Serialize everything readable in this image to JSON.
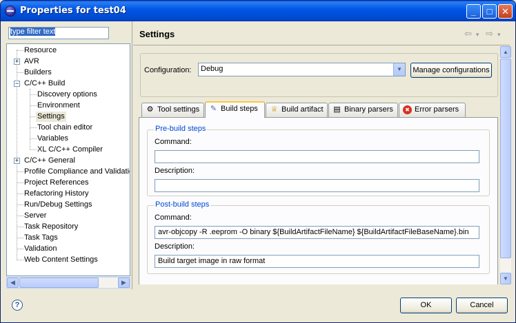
{
  "window": {
    "title": "Properties for test04",
    "minimize": "_",
    "maximize": "□",
    "close": "✕"
  },
  "filter": {
    "value": "type filter text"
  },
  "tree": {
    "items": [
      {
        "label": "Resource",
        "expander": ""
      },
      {
        "label": "AVR",
        "expander": "+"
      },
      {
        "label": "Builders",
        "expander": ""
      },
      {
        "label": "C/C++ Build",
        "expander": "−"
      },
      {
        "label": "Discovery options",
        "expander": ""
      },
      {
        "label": "Environment",
        "expander": ""
      },
      {
        "label": "Settings",
        "expander": "",
        "selected": true
      },
      {
        "label": "Tool chain editor",
        "expander": ""
      },
      {
        "label": "Variables",
        "expander": ""
      },
      {
        "label": "XL C/C++ Compiler",
        "expander": ""
      },
      {
        "label": "C/C++ General",
        "expander": "+"
      },
      {
        "label": "Profile Compliance and Validatic",
        "expander": ""
      },
      {
        "label": "Project References",
        "expander": ""
      },
      {
        "label": "Refactoring History",
        "expander": ""
      },
      {
        "label": "Run/Debug Settings",
        "expander": ""
      },
      {
        "label": "Server",
        "expander": ""
      },
      {
        "label": "Task Repository",
        "expander": ""
      },
      {
        "label": "Task Tags",
        "expander": ""
      },
      {
        "label": "Validation",
        "expander": ""
      },
      {
        "label": "Web Content Settings",
        "expander": ""
      }
    ]
  },
  "main": {
    "title": "Settings",
    "back_icon": "⇦",
    "forward_icon": "⇨",
    "dropdown_icon": "▾",
    "configuration": {
      "label": "Configuration:",
      "value": "Debug",
      "manage_label": "Manage configurations"
    },
    "tabs": [
      {
        "label": "Tool settings",
        "icon": "tool-settings-icon",
        "glyph": "⚙"
      },
      {
        "label": "Build steps",
        "icon": "build-steps-icon",
        "glyph": "✎",
        "active": true
      },
      {
        "label": "Build artifact",
        "icon": "build-artifact-icon",
        "glyph": "♕"
      },
      {
        "label": "Binary parsers",
        "icon": "binary-parsers-icon",
        "glyph": "▤"
      },
      {
        "label": "Error parsers",
        "icon": "error-parsers-icon",
        "glyph": "✖"
      }
    ],
    "prebuild": {
      "title": "Pre-build steps",
      "command_label": "Command:",
      "command_value": "",
      "description_label": "Description:",
      "description_value": ""
    },
    "postbuild": {
      "title": "Post-build steps",
      "command_label": "Command:",
      "command_value": "avr-objcopy -R .eeprom -O binary ${BuildArtifactFileName}  ${BuildArtifactFileBaseName}.bin",
      "description_label": "Description:",
      "description_value": "Build target image in raw format"
    }
  },
  "footer": {
    "help": "?",
    "ok_label": "OK",
    "cancel_label": "Cancel"
  },
  "colors": {
    "titlebar": "#0058e6",
    "group_title": "#0046d5",
    "active_tab_accent": "#ffc83c"
  }
}
